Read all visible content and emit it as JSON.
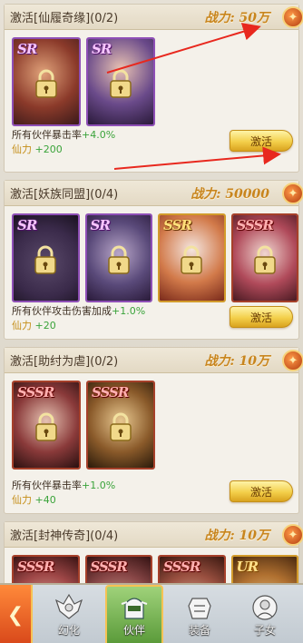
{
  "sections": [
    {
      "title": "激活[仙履奇缘](0/2)",
      "power": "战力: 50万",
      "cards": [
        {
          "rarity": "SR",
          "tier": "purple",
          "hue": "#b4513a"
        },
        {
          "rarity": "SR",
          "tier": "purple",
          "hue": "#7a4a7a"
        }
      ],
      "bonus_text": "所有伙伴暴击率",
      "bonus_value": "+4.0%",
      "power_label": "仙力",
      "power_value": "+200",
      "button": "激活"
    },
    {
      "title": "激活[妖族同盟](0/4)",
      "power": "战力: 50000",
      "cards": [
        {
          "rarity": "SR",
          "tier": "purple",
          "hue": "#6a4a8a"
        },
        {
          "rarity": "SR",
          "tier": "purple",
          "hue": "#6a5a9a"
        },
        {
          "rarity": "SSR",
          "tier": "gold",
          "hue": "#c47a3a"
        },
        {
          "rarity": "SSSR",
          "tier": "red",
          "hue": "#b04a5a"
        }
      ],
      "bonus_text": "所有伙伴攻击伤害加成",
      "bonus_value": "+1.0%",
      "power_label": "仙力",
      "power_value": "+20",
      "button": "激活"
    },
    {
      "title": "激活[助纣为虐](0/2)",
      "power": "战力: 10万",
      "cards": [
        {
          "rarity": "SSSR",
          "tier": "red",
          "hue": "#a04040"
        },
        {
          "rarity": "SSSR",
          "tier": "red",
          "hue": "#8a5a3a"
        }
      ],
      "bonus_text": "所有伙伴暴击率",
      "bonus_value": "+1.0%",
      "power_label": "仙力",
      "power_value": "+40",
      "button": "激活"
    },
    {
      "title": "激活[封神传奇](0/4)",
      "power": "战力: 10万",
      "cards": [
        {
          "rarity": "SSSR",
          "tier": "red",
          "hue": "#a04848"
        },
        {
          "rarity": "SSSR",
          "tier": "red",
          "hue": "#8a4848"
        },
        {
          "rarity": "SSSR",
          "tier": "red",
          "hue": "#9a5040"
        },
        {
          "rarity": "UR",
          "tier": "gold",
          "hue": "#b07030"
        }
      ]
    }
  ],
  "nav": {
    "back": "back-arrow",
    "tabs": [
      {
        "label": "幻化",
        "icon": "phantom-icon"
      },
      {
        "label": "伙伴",
        "icon": "partner-icon",
        "active": true
      },
      {
        "label": "装备",
        "icon": "equipment-icon"
      },
      {
        "label": "子女",
        "icon": "children-icon"
      }
    ]
  },
  "annotation_color": "#e8281e"
}
